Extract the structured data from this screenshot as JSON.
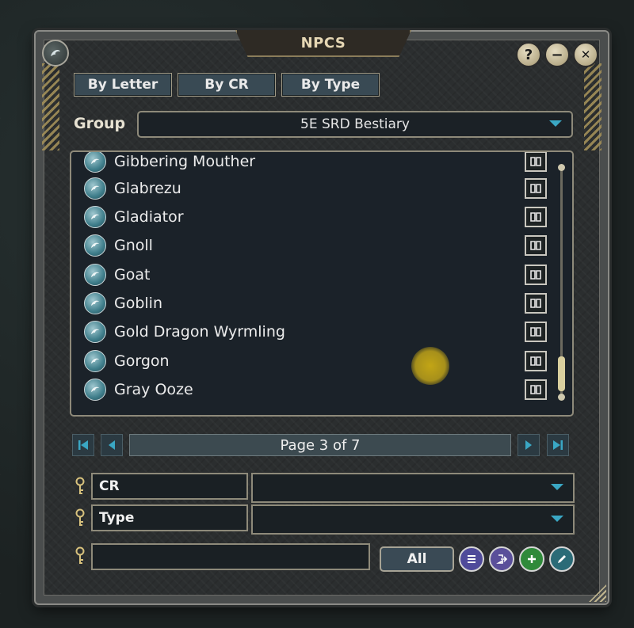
{
  "window": {
    "title": "NPCS",
    "help_label": "?",
    "minimize_label": "−",
    "close_label": "✕"
  },
  "tabs": [
    {
      "label": "By Letter"
    },
    {
      "label": "By CR"
    },
    {
      "label": "By Type"
    }
  ],
  "group": {
    "label": "Group",
    "value": "5E SRD Bestiary"
  },
  "list": {
    "items": [
      {
        "name": "Gibbering Mouther"
      },
      {
        "name": "Glabrezu"
      },
      {
        "name": "Gladiator"
      },
      {
        "name": "Gnoll"
      },
      {
        "name": "Goat"
      },
      {
        "name": "Goblin"
      },
      {
        "name": "Gold Dragon Wyrmling"
      },
      {
        "name": "Gorgon"
      },
      {
        "name": "Gray Ooze"
      }
    ]
  },
  "pager": {
    "label": "Page 3 of 7"
  },
  "filters": [
    {
      "label": "CR",
      "value": ""
    },
    {
      "label": "Type",
      "value": ""
    }
  ],
  "search": {
    "value": "",
    "all_label": "All"
  },
  "colors": {
    "accent": "#3aa7c4",
    "gold": "#d8c27d",
    "list_button": "#4f4a9a",
    "export_button": "#5a4f9a",
    "add_button": "#2f8a3a",
    "edit_button": "#2b6b77"
  },
  "icons": {
    "row_icon": "npc-dragon-icon",
    "row_action": "book-icon",
    "add": "plus-icon",
    "edit": "pencil-icon"
  }
}
